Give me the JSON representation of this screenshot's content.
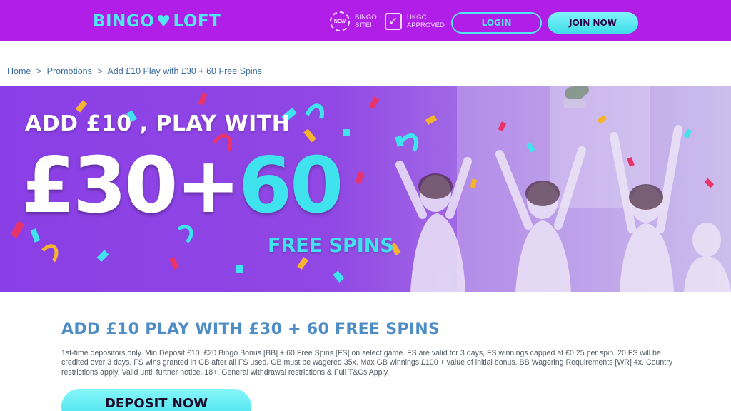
{
  "header": {
    "logo_left": "BINGO",
    "logo_heart": "♥",
    "logo_right": "LOFT",
    "badge_new_icon_text": "NEW",
    "badge_new_line1": "BINGO",
    "badge_new_line2": "SITE!",
    "badge_ukgc_line1": "UKGC",
    "badge_ukgc_line2": "APPROVED",
    "login_label": "LOGIN",
    "join_label": "JOIN NOW"
  },
  "breadcrumb": {
    "items": [
      "Home",
      "Promotions",
      "Add £10 Play with £30 + 60 Free Spins"
    ],
    "separator": ">"
  },
  "hero": {
    "line1": "ADD £10 , PLAY WITH",
    "amount": "£30+",
    "spins_number": "60",
    "spins_label": "FREE SPINS"
  },
  "offer": {
    "title": "ADD £10 PLAY WITH £30 + 60 FREE SPINS",
    "terms": "1st-time depositors only. Min Deposit £10. £20 Bingo Bonus [BB] + 60 Free Spins [FS] on select game. FS are valid for 3 days, FS winnings capped at £0.25 per spin. 20 FS will be credited over 3 days. FS wins granted in GB after all FS used. GB must be wagered 35x. Max GB winnings £100 + value of initial bonus. BB Wagering Requirements [WR] 4x. Country restrictions apply. Valid until further notice. 18+. General withdrawal restrictions & Full T&Cs Apply.",
    "deposit_label": "DEPOSIT NOW"
  },
  "colors": {
    "header_bg": "#b11ee8",
    "accent_cyan": "#4fe8f2",
    "title_blue": "#4f8dc4",
    "hero_purple": "#8a3fe6"
  }
}
